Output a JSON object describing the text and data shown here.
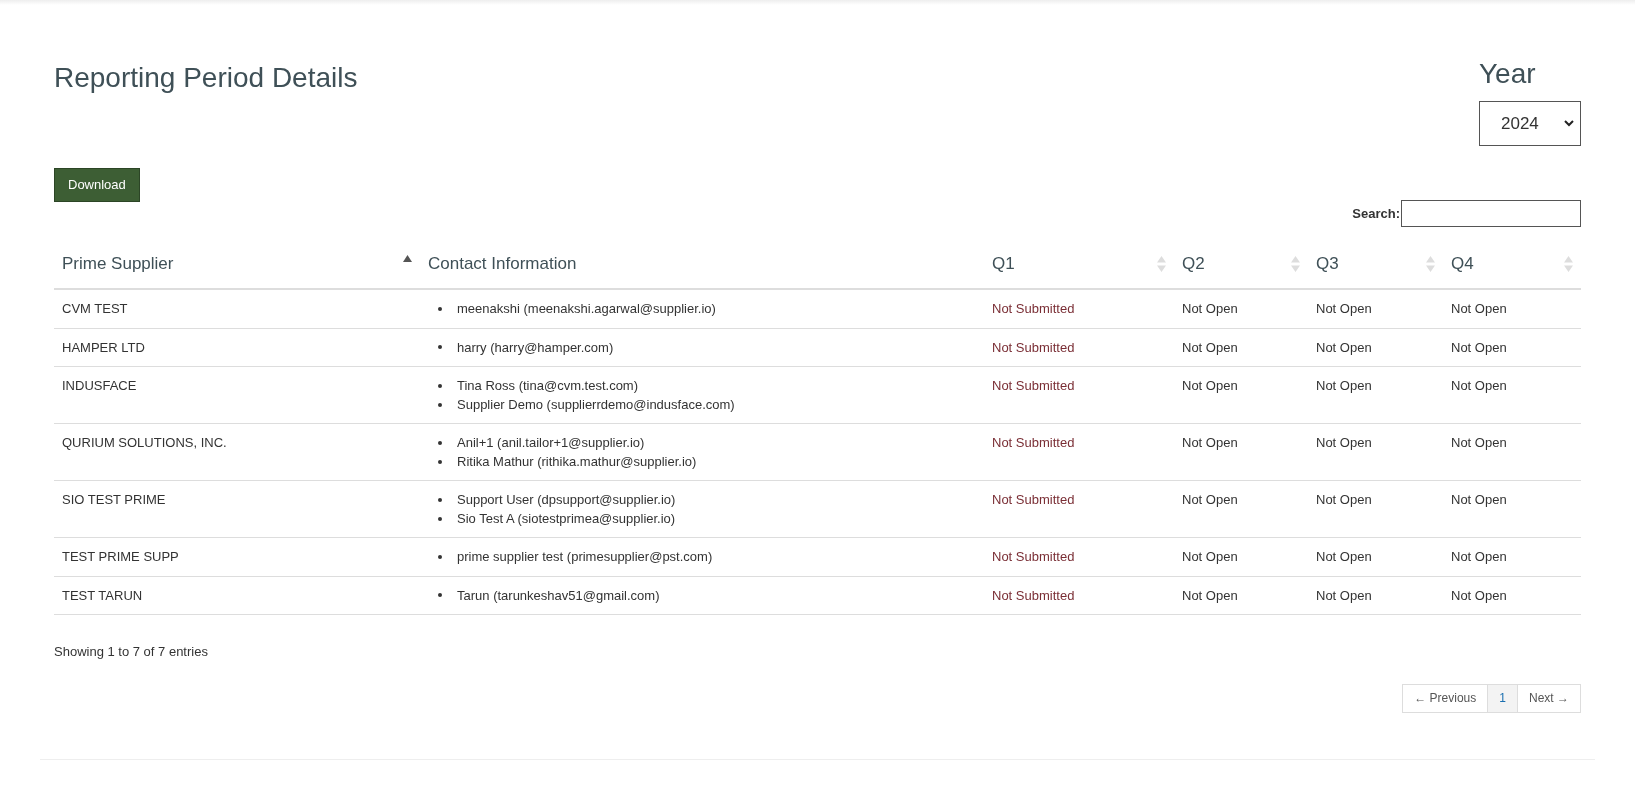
{
  "title": "Reporting Period Details",
  "year": {
    "label": "Year",
    "value": "2024"
  },
  "download_button": "Download",
  "search": {
    "label": "Search:"
  },
  "table": {
    "columns": [
      {
        "label": "Prime Supplier",
        "sortable": true,
        "sorted": true
      },
      {
        "label": "Contact Information",
        "sortable": false,
        "sorted": false
      },
      {
        "label": "Q1",
        "sortable": true,
        "sorted": false
      },
      {
        "label": "Q2",
        "sortable": true,
        "sorted": false
      },
      {
        "label": "Q3",
        "sortable": true,
        "sorted": false
      },
      {
        "label": "Q4",
        "sortable": true,
        "sorted": false
      }
    ],
    "rows": [
      {
        "supplier": "CVM TEST",
        "contacts": [
          "meenakshi (meenakshi.agarwal@supplier.io)"
        ],
        "quarters": [
          {
            "text": "Not Submitted",
            "color": "#7a2e35"
          },
          {
            "text": "Not Open",
            "color": "#333333"
          },
          {
            "text": "Not Open",
            "color": "#333333"
          },
          {
            "text": "Not Open",
            "color": "#333333"
          }
        ]
      },
      {
        "supplier": "HAMPER LTD",
        "contacts": [
          "harry (harry@hamper.com)"
        ],
        "quarters": [
          {
            "text": "Not Submitted",
            "color": "#7a2e35"
          },
          {
            "text": "Not Open",
            "color": "#333333"
          },
          {
            "text": "Not Open",
            "color": "#333333"
          },
          {
            "text": "Not Open",
            "color": "#333333"
          }
        ]
      },
      {
        "supplier": "INDUSFACE",
        "contacts": [
          "Tina Ross (tina@cvm.test.com)",
          "Supplier Demo (supplierrdemo@indusface.com)"
        ],
        "quarters": [
          {
            "text": "Not Submitted",
            "color": "#7a2e35"
          },
          {
            "text": "Not Open",
            "color": "#333333"
          },
          {
            "text": "Not Open",
            "color": "#333333"
          },
          {
            "text": "Not Open",
            "color": "#333333"
          }
        ]
      },
      {
        "supplier": "QURIUM SOLUTIONS, INC.",
        "contacts": [
          "Anil+1 (anil.tailor+1@supplier.io)",
          "Ritika Mathur (rithika.mathur@supplier.io)"
        ],
        "quarters": [
          {
            "text": "Not Submitted",
            "color": "#7a2e35"
          },
          {
            "text": "Not Open",
            "color": "#333333"
          },
          {
            "text": "Not Open",
            "color": "#333333"
          },
          {
            "text": "Not Open",
            "color": "#333333"
          }
        ]
      },
      {
        "supplier": "SIO TEST PRIME",
        "contacts": [
          "Support User (dpsupport@supplier.io)",
          "Sio Test A (siotestprimea@supplier.io)"
        ],
        "quarters": [
          {
            "text": "Not Submitted",
            "color": "#7a2e35"
          },
          {
            "text": "Not Open",
            "color": "#333333"
          },
          {
            "text": "Not Open",
            "color": "#333333"
          },
          {
            "text": "Not Open",
            "color": "#333333"
          }
        ]
      },
      {
        "supplier": "TEST PRIME SUPP",
        "contacts": [
          "prime supplier test (primesupplier@pst.com)"
        ],
        "quarters": [
          {
            "text": "Not Submitted",
            "color": "#7a2e35"
          },
          {
            "text": "Not Open",
            "color": "#333333"
          },
          {
            "text": "Not Open",
            "color": "#333333"
          },
          {
            "text": "Not Open",
            "color": "#333333"
          }
        ]
      },
      {
        "supplier": "TEST TARUN",
        "contacts": [
          "Tarun (tarunkeshav51@gmail.com)"
        ],
        "quarters": [
          {
            "text": "Not Submitted",
            "color": "#7a2e35"
          },
          {
            "text": "Not Open",
            "color": "#333333"
          },
          {
            "text": "Not Open",
            "color": "#333333"
          },
          {
            "text": "Not Open",
            "color": "#333333"
          }
        ]
      }
    ]
  },
  "info": "Showing 1 to 7 of 7 entries",
  "pagination": [
    {
      "label": "← Previous",
      "selected": false
    },
    {
      "label": "1",
      "selected": true
    },
    {
      "label": "Next →",
      "selected": false
    }
  ]
}
